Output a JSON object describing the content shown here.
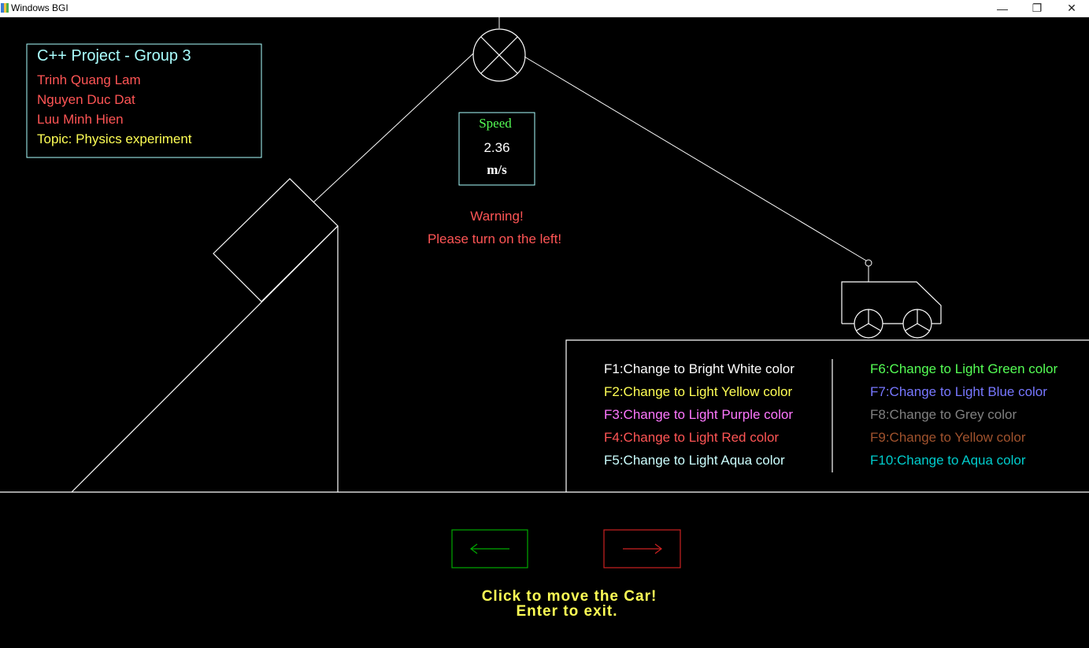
{
  "window": {
    "title": "Windows BGI",
    "minimize_glyph": "—",
    "restore_glyph": "❐",
    "close_glyph": "✕"
  },
  "info_box": {
    "title": "C++ Project - Group 3",
    "members": [
      "Trinh Quang Lam",
      "Nguyen Duc Dat",
      "Luu Minh Hien"
    ],
    "topic": "Topic: Physics experiment"
  },
  "speed": {
    "label": "Speed",
    "value": "2.36",
    "unit": "m/s"
  },
  "warning": {
    "line1": "Warning!",
    "line2": "Please turn on the left!"
  },
  "color_keys": {
    "left": [
      {
        "text": "F1:Change to Bright White color",
        "color": "#ffffff"
      },
      {
        "text": "F2:Change to Light Yellow color",
        "color": "#ffff55"
      },
      {
        "text": "F3:Change to Light Purple color",
        "color": "#ff77ff"
      },
      {
        "text": "F4:Change to Light Red color",
        "color": "#ff5555"
      },
      {
        "text": "F5:Change to Light Aqua color",
        "color": "#ccffff"
      }
    ],
    "right": [
      {
        "text": "F6:Change to Light Green color",
        "color": "#55ff55"
      },
      {
        "text": "F7:Change to Light Blue color",
        "color": "#7777ff"
      },
      {
        "text": "F8:Change to Grey color",
        "color": "#808080"
      },
      {
        "text": "F9:Change to Yellow color",
        "color": "#a0522d"
      },
      {
        "text": "F10:Change to Aqua color",
        "color": "#00cccc"
      }
    ]
  },
  "controls": {
    "left_arrow_glyph": "⟵",
    "right_arrow_glyph": "⟶",
    "instruction1": "Click to move the Car!",
    "instruction2": "Enter to exit."
  },
  "colors": {
    "info_title": "#aaffff",
    "member": "#ff5555",
    "topic": "#ffff55",
    "speed_label": "#55ff55",
    "warning": "#ff5555",
    "left_button": "#00aa00",
    "right_button": "#cc2222",
    "instruction": "#ffff55",
    "box_border": "#aaffff"
  }
}
